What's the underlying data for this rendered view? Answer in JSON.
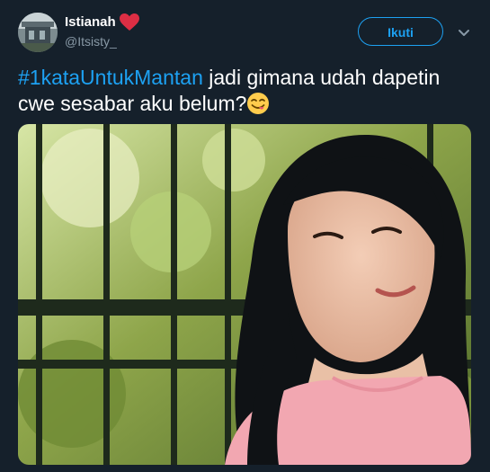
{
  "tweet": {
    "author": {
      "display_name": "Istianah",
      "handle": "@Itsisty_",
      "name_emoji_icon": "red-heart-icon",
      "avatar_icon": "profile-photo-avatar"
    },
    "follow_label": "Ikuti",
    "menu_icon": "chevron-down-icon",
    "text": {
      "hashtag": "#1kataUntukMantan",
      "body": " jadi gimana udah dapetin cwe sesabar aku belum?",
      "emoji_icon": "face-savoring-food-emoji"
    },
    "media": {
      "photo_icon": "selfie-photo"
    }
  },
  "colors": {
    "background": "#15202b",
    "accent": "#1da1f2",
    "secondary_text": "#8899a6",
    "primary_text": "#ffffff"
  }
}
